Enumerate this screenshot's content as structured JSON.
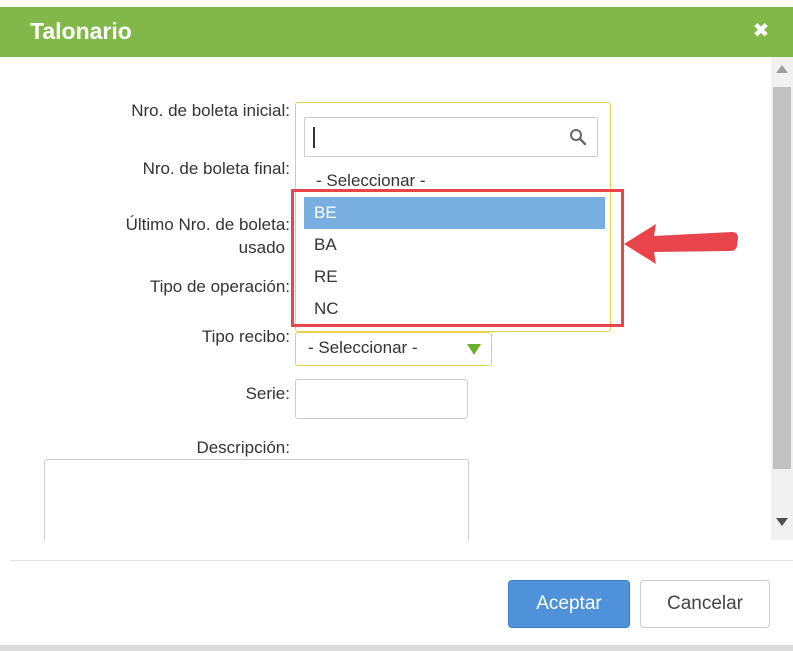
{
  "dialog": {
    "title": "Talonario",
    "close_icon": "close-icon"
  },
  "form": {
    "nro_inicial_label": "Nro. de boleta inicial:",
    "nro_final_label": "Nro. de boleta final:",
    "ultimo_label_line1": "Último Nro. de boleta:",
    "ultimo_label_line2": "usado",
    "tipo_operacion_label": "Tipo de operación:",
    "tipo_recibo_label": "Tipo recibo:",
    "tipo_recibo_value": "- Seleccionar -",
    "serie_label": "Serie:",
    "serie_value": "",
    "descripcion_label": "Descripción:",
    "descripcion_value": ""
  },
  "dropdown": {
    "search_value": "",
    "placeholder_option": "- Seleccionar -",
    "options": [
      "BE",
      "BA",
      "RE",
      "NC"
    ],
    "selected": "BE"
  },
  "footer": {
    "accept_label": "Aceptar",
    "cancel_label": "Cancelar"
  },
  "colors": {
    "title_bar": "#82b84a",
    "primary_button": "#4f92d9",
    "selected_option": "#78aee0",
    "annotation": "#e8444b",
    "select_border": "#e8d24a"
  }
}
